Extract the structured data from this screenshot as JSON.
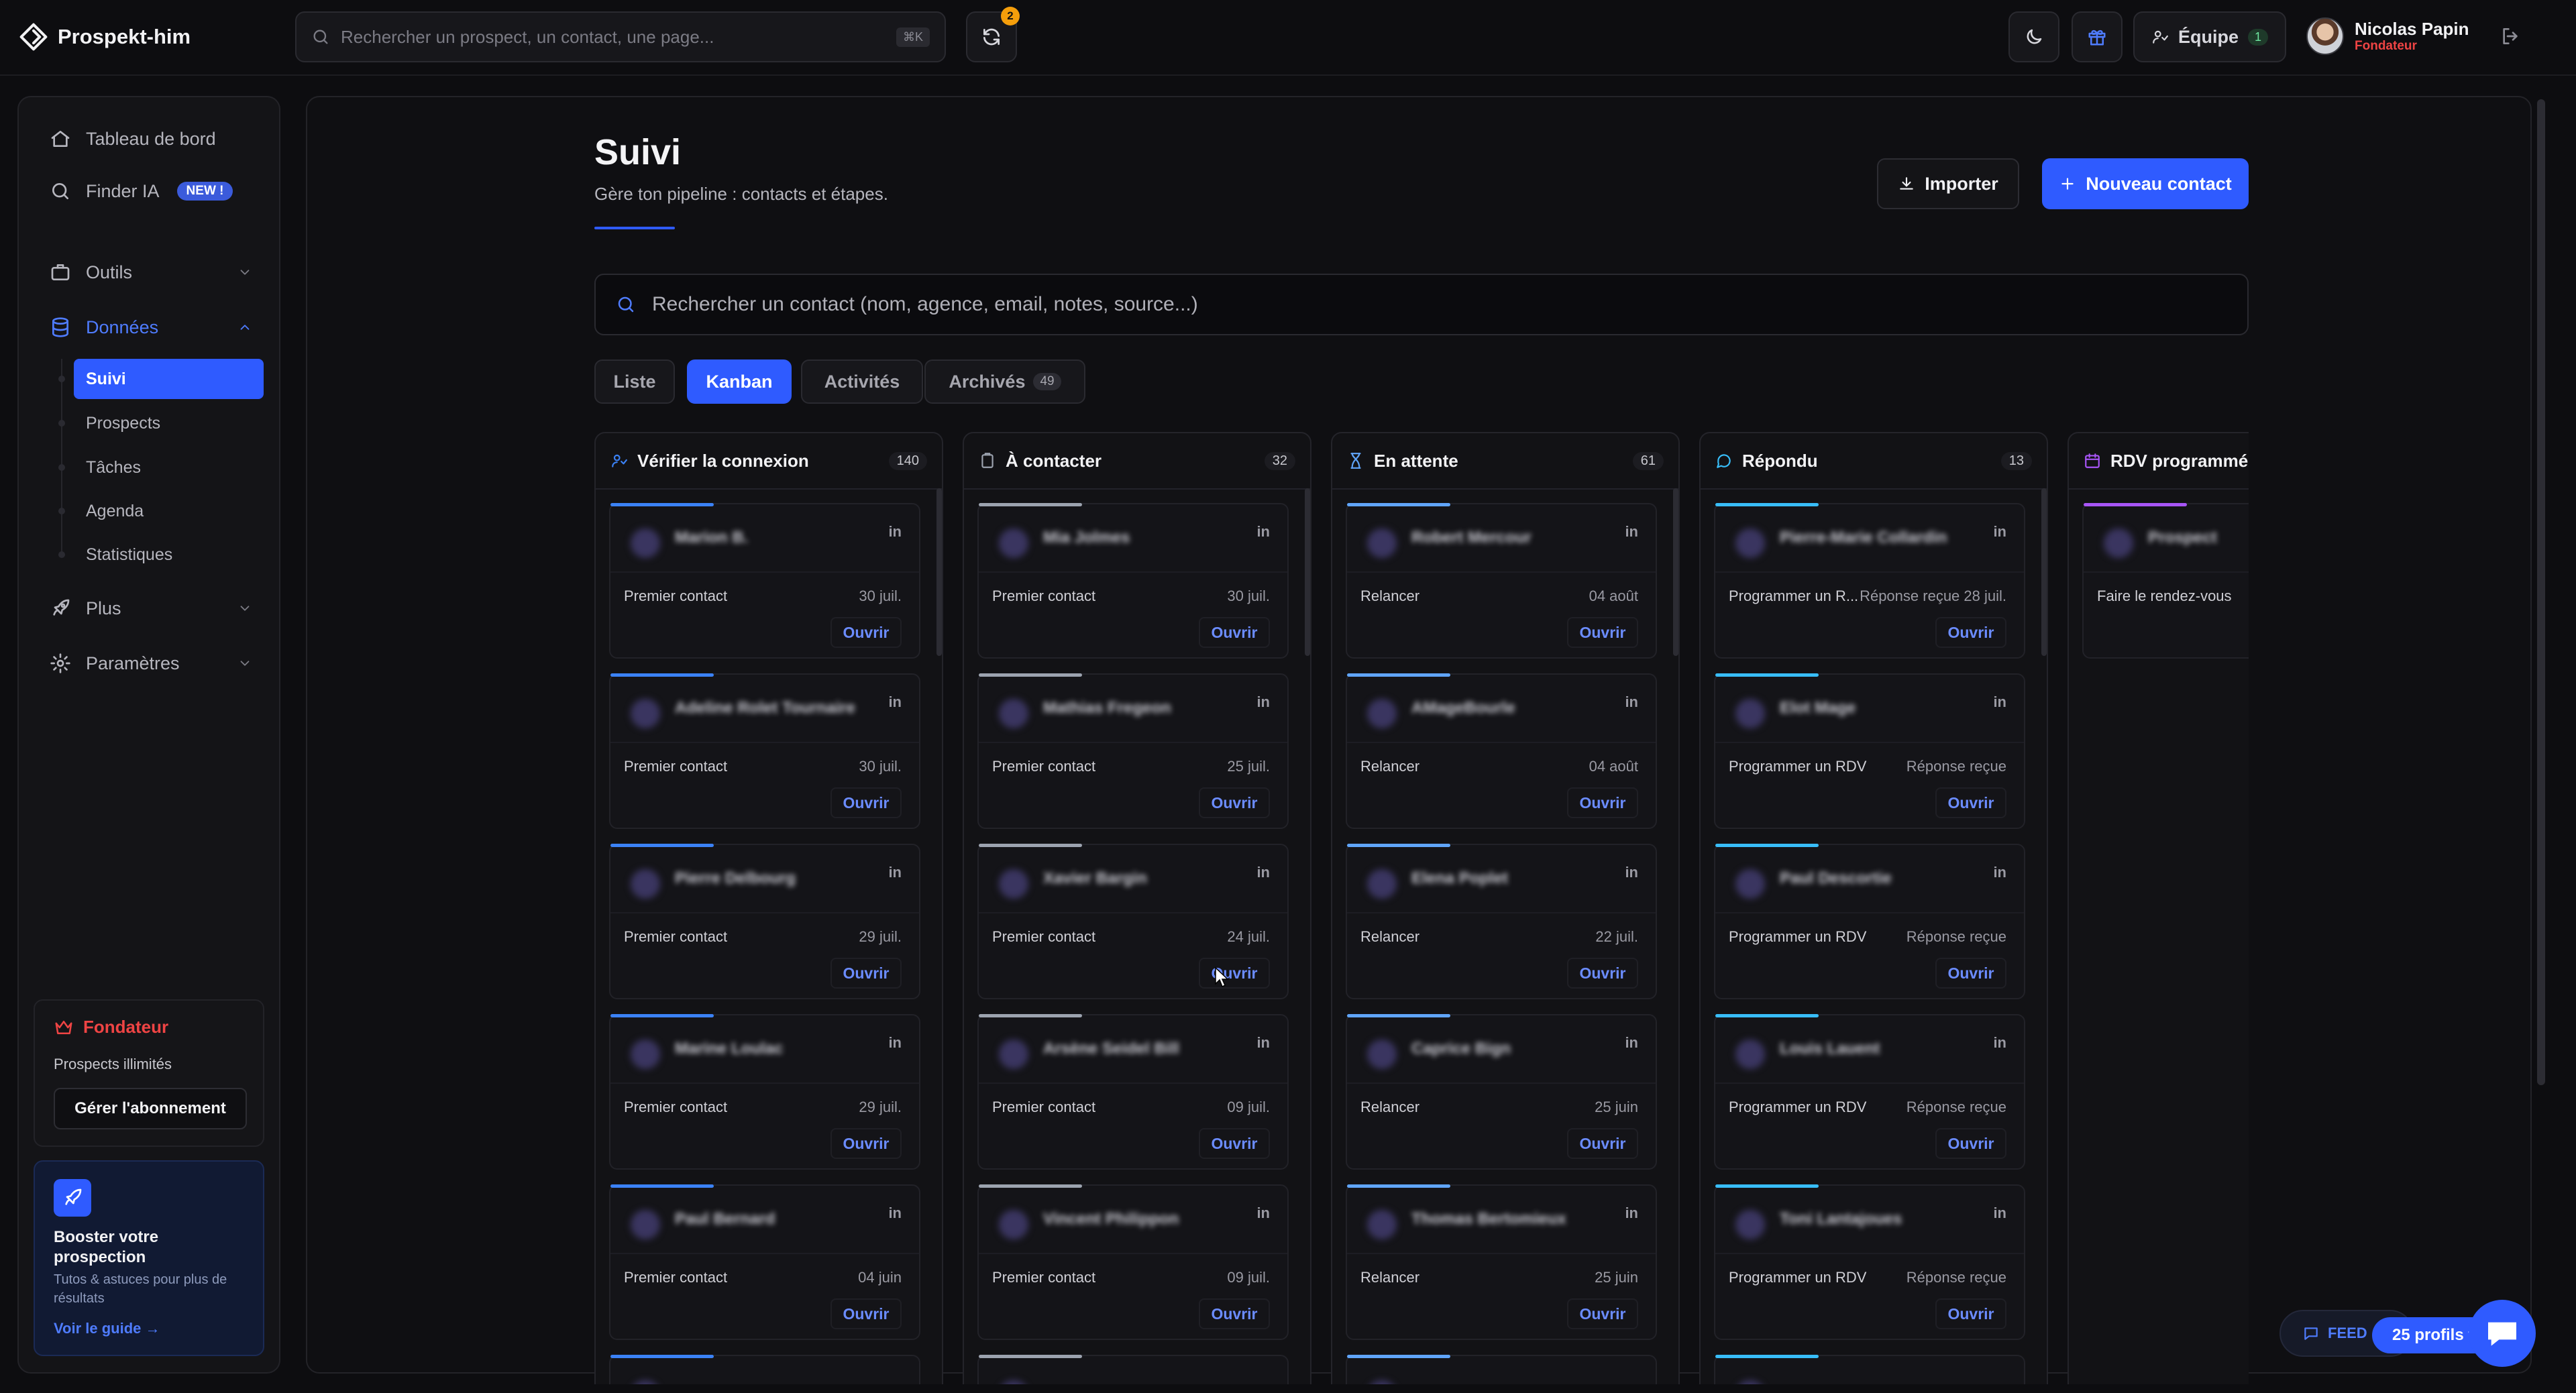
{
  "app": {
    "name": "Prospekt-him"
  },
  "topbar": {
    "search_placeholder": "Rechercher un prospect, un contact, une page...",
    "search_kbd": "⌘K",
    "notif_count": "2",
    "team_label": "Équipe",
    "team_count": "1",
    "user_name": "Nicolas Papin",
    "user_role": "Fondateur"
  },
  "sidebar": {
    "items": [
      {
        "label": "Tableau de bord",
        "icon": "home-icon"
      },
      {
        "label": "Finder IA",
        "icon": "search-icon",
        "badge": "NEW !"
      },
      {
        "label": "Outils",
        "icon": "briefcase-icon"
      },
      {
        "label": "Données",
        "icon": "database-icon"
      },
      {
        "label": "Plus",
        "icon": "rocket-icon"
      },
      {
        "label": "Paramètres",
        "icon": "gear-icon"
      }
    ],
    "sub_items": [
      "Suivi",
      "Prospects",
      "Tâches",
      "Agenda",
      "Statistiques"
    ],
    "plan": {
      "title": "Fondateur",
      "subtitle": "Prospects illimités",
      "button": "Gérer l'abonnement"
    },
    "boost": {
      "title": "Booster votre prospection",
      "subtitle": "Tutos & astuces pour plus de résultats",
      "link": "Voir le guide →"
    }
  },
  "page": {
    "title": "Suivi",
    "subtitle": "Gère ton pipeline : contacts et étapes.",
    "import_label": "Importer",
    "new_contact_label": "Nouveau contact",
    "search_placeholder": "Rechercher un contact (nom, agence, email, notes, source...)",
    "tabs": [
      {
        "label": "Liste"
      },
      {
        "label": "Kanban"
      },
      {
        "label": "Activités"
      },
      {
        "label": "Archivés",
        "count": "49"
      }
    ]
  },
  "kanban": {
    "open_label": "Ouvrir",
    "linkedin_label": "in",
    "columns": [
      {
        "title": "Vérifier la connexion",
        "count": "140",
        "icon": "user-check-icon",
        "color": "#3b82f6",
        "cards": [
          {
            "name": "Marion B.",
            "stage": "Premier contact",
            "date": "30 juil."
          },
          {
            "name": "Adeline Rolet Tournaire",
            "stage": "Premier contact",
            "date": "30 juil."
          },
          {
            "name": "Pierre Delbourg",
            "stage": "Premier contact",
            "date": "29 juil."
          },
          {
            "name": "Marine Loulac",
            "stage": "Premier contact",
            "date": "29 juil."
          },
          {
            "name": "Paul Bernard",
            "stage": "Premier contact",
            "date": "04 juin"
          }
        ]
      },
      {
        "title": "À contacter",
        "count": "32",
        "icon": "clipboard-icon",
        "color": "#9ca3af",
        "cards": [
          {
            "name": "Mia Jolmes",
            "stage": "Premier contact",
            "date": "30 juil."
          },
          {
            "name": "Mathias Fregeon",
            "stage": "Premier contact",
            "date": "25 juil."
          },
          {
            "name": "Xavier Bargin",
            "stage": "Premier contact",
            "date": "24 juil."
          },
          {
            "name": "Arsène Seidel Bill",
            "stage": "Premier contact",
            "date": "09 juil."
          },
          {
            "name": "Vincent Philippon",
            "stage": "Premier contact",
            "date": "09 juil."
          }
        ]
      },
      {
        "title": "En attente",
        "count": "61",
        "icon": "hourglass-icon",
        "color": "#60a5fa",
        "cards": [
          {
            "name": "Robert Mercour",
            "stage": "Relancer",
            "date": "04 août"
          },
          {
            "name": "AMageBourle",
            "stage": "Relancer",
            "date": "04 août"
          },
          {
            "name": "Elena Poplet",
            "stage": "Relancer",
            "date": "22 juil."
          },
          {
            "name": "Caprice Bign",
            "stage": "Relancer",
            "date": "25 juin"
          },
          {
            "name": "Thomas Bertomieux",
            "stage": "Relancer",
            "date": "25 juin"
          }
        ]
      },
      {
        "title": "Répondu",
        "count": "13",
        "icon": "chat-icon",
        "color": "#38bdf8",
        "cards": [
          {
            "name": "Pierre-Marie Collardin",
            "stage": "Programmer un R...",
            "date": "Réponse reçue 28 juil."
          },
          {
            "name": "Elot Mage",
            "stage": "Programmer un RDV",
            "date": "Réponse reçue"
          },
          {
            "name": "Paul Descortie",
            "stage": "Programmer un RDV",
            "date": "Réponse reçue"
          },
          {
            "name": "Louis Lauent",
            "stage": "Programmer un RDV",
            "date": "Réponse reçue"
          },
          {
            "name": "Toni Lantajoues",
            "stage": "Programmer un RDV",
            "date": "Réponse reçue"
          }
        ]
      },
      {
        "title": "RDV programmé",
        "count": "",
        "icon": "calendar-icon",
        "color": "#a855f7",
        "cards": [
          {
            "name": "Prospect",
            "stage": "Faire le rendez-vous",
            "date": ""
          }
        ]
      }
    ]
  },
  "widgets": {
    "feedback_label": "FEED",
    "profiles_label": "25 profils t"
  }
}
